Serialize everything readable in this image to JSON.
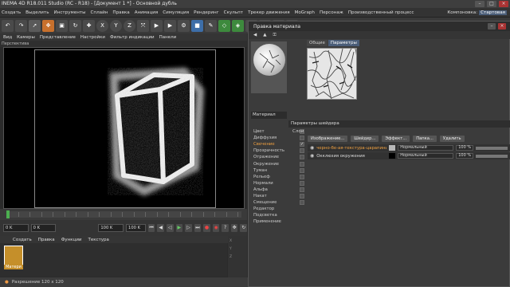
{
  "window": {
    "title": "INEMA 4D R18.011 Studio (RC - R18) - [Документ 1 *] - Основной дубль"
  },
  "menubar": {
    "items": [
      "Создать",
      "Выделить",
      "Инструменты",
      "Моделирование",
      "Меш",
      "Сплайн",
      "Объекты",
      "Правка",
      "Анимация",
      "Симуляция",
      "Рендеринг",
      "Скульпт",
      "Трекер движения",
      "MoGraph",
      "Персонаж",
      "Производственный процесс"
    ],
    "layout_label": "Компоновка:",
    "layout_value": "Стартовая"
  },
  "toolbar": {
    "x_label": "X",
    "y_label": "Y",
    "z_label": "Z"
  },
  "viewport": {
    "menu": [
      "Вид",
      "Камеры",
      "Представление",
      "Настройки",
      "Фильтр индикации",
      "Панели"
    ],
    "title": "Перспектива"
  },
  "timeline": {
    "ticks": [
      "0",
      "5",
      "10",
      "15",
      "20",
      "25",
      "30",
      "35",
      "40",
      "45",
      "50",
      "55",
      "60",
      "65",
      "70",
      "75",
      "80",
      "85",
      "90",
      "95",
      "100"
    ]
  },
  "transport": {
    "start_frame": "0 K",
    "current_frame": "0 K",
    "end_frame": "100 K",
    "end_frame_2": "100 K"
  },
  "material_manager": {
    "menu": [
      "Создать",
      "Правка",
      "Функции",
      "Текстура"
    ],
    "material_name": "Матери"
  },
  "statusbar": {
    "text": "Разрешение 120 x 120"
  },
  "material_editor": {
    "title": "Правка материала",
    "tabs": [
      "Общие",
      "Параметры"
    ],
    "active_tab": "Параметры",
    "material_label": "Материал",
    "channels": [
      {
        "label": "Цвет",
        "checked": false
      },
      {
        "label": "Диффузия",
        "checked": false
      },
      {
        "label": "Свечение",
        "checked": true
      },
      {
        "label": "Прозрачность",
        "checked": false
      },
      {
        "label": "Отражение",
        "checked": false
      },
      {
        "label": "Окружение",
        "checked": false
      },
      {
        "label": "Туман",
        "checked": false
      },
      {
        "label": "Рельеф",
        "checked": false
      },
      {
        "label": "Нормали",
        "checked": false
      },
      {
        "label": "Альфа",
        "checked": false
      },
      {
        "label": "Накат",
        "checked": false
      },
      {
        "label": "Смещение",
        "checked": false
      },
      {
        "label": "Редактор",
        "checked": null
      },
      {
        "label": "Подсветка",
        "checked": null
      },
      {
        "label": "Применение",
        "checked": null
      }
    ],
    "shader_params_label": "Параметры шейдера",
    "layers_label": "Слои",
    "layer_buttons": [
      "Изображение...",
      "Шейдер...",
      "Эффект...",
      "Папка...",
      "Удалить"
    ],
    "layers": [
      {
        "name": "черно-бе-ая-текстура-царапины",
        "mode": "Нормальный",
        "percent": "100 %",
        "swatch_color": "#b8b8b8",
        "highlight": true
      },
      {
        "name": "Окклюзия окружения",
        "mode": "Нормальный",
        "percent": "100 %",
        "swatch_color": "#000000",
        "highlight": false
      }
    ]
  }
}
